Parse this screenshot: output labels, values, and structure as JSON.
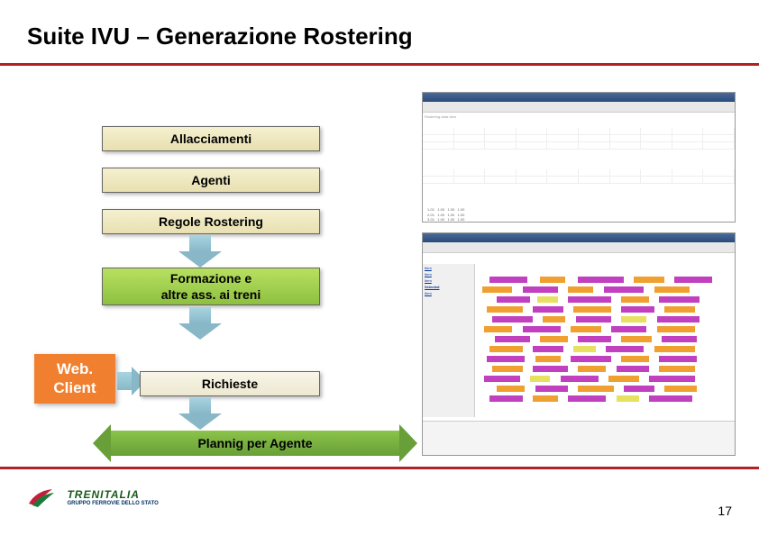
{
  "title": "Suite IVU – Generazione Rostering",
  "boxes": {
    "allacciamenti": "Allacciamenti",
    "agenti": "Agenti",
    "regole": "Regole Rostering",
    "formazione": "Formazione e\naltre ass. ai treni",
    "richieste": "Richieste",
    "webclient": "Web.\nClient",
    "planning": "Plannig per Agente"
  },
  "logo": {
    "brand": "TRENITALIA",
    "subtitle": "GRUPPO FERROVIE DELLO STATO"
  },
  "page_number": "17"
}
